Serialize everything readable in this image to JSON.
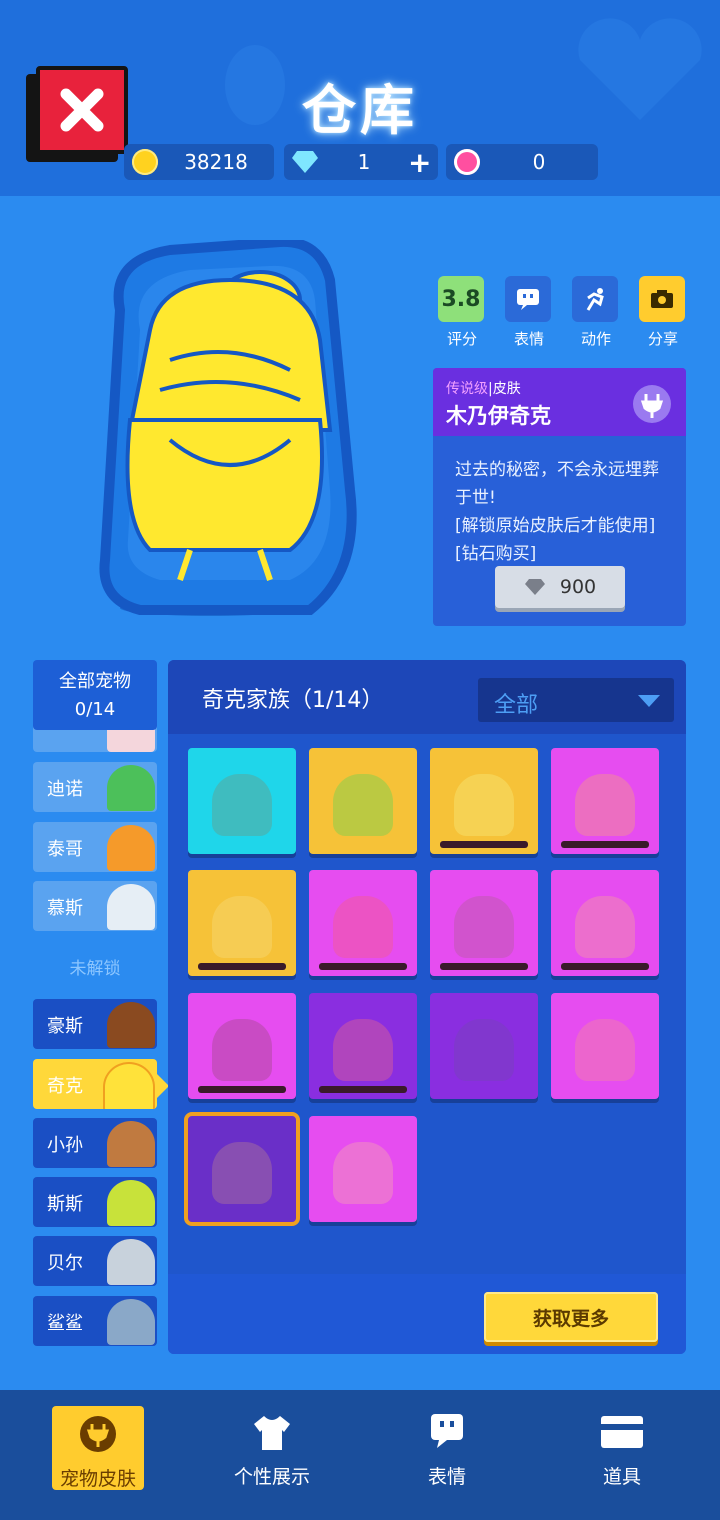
{
  "header": {
    "title": "仓库",
    "currencies": [
      {
        "icon": "gold-coin-icon",
        "value": "38218",
        "color": "#ffd21f"
      },
      {
        "icon": "diamond-icon",
        "value": "1",
        "color": "#7fe6ff"
      },
      {
        "icon": "lotus-icon",
        "value": "0",
        "color": "#ff4fa0"
      }
    ],
    "add_symbol": "+"
  },
  "actions": [
    {
      "name": "rating",
      "value": "3.8",
      "label": "评分",
      "color": "#8ee07a"
    },
    {
      "name": "emote",
      "label": "表情",
      "color": "#2b6ad8"
    },
    {
      "name": "motion",
      "label": "动作",
      "color": "#2b6ad8"
    },
    {
      "name": "share",
      "label": "分享",
      "color": "#ffcc2e"
    }
  ],
  "skin_info": {
    "rarity": "传说级",
    "separator": "|",
    "type": "皮肤",
    "name": "木乃伊奇克",
    "description": "过去的秘密，不会永远埋葬于世!\n[解锁原始皮肤后才能使用][钻石购买]",
    "price": "900"
  },
  "pet_list": {
    "all_label": "全部宠物",
    "all_count": "0/14",
    "unlocked_items": [
      "迪诺",
      "泰哥",
      "慕斯"
    ],
    "locked_label": "未解锁",
    "locked_items": [
      "豪斯",
      "奇克",
      "小孙",
      "斯斯",
      "贝尔",
      "鲨鲨"
    ],
    "selected": "奇克"
  },
  "family": {
    "title": "奇克家族（1/14）",
    "filter": "全部",
    "tiles": [
      {
        "bg": "#1fd6ea",
        "blob": "#5aa89a",
        "bar": false
      },
      {
        "bg": "#f6c238",
        "blob": "#8ad04a",
        "bar": false
      },
      {
        "bg": "#f6c238",
        "blob": "#f6e06a",
        "bar": true
      },
      {
        "bg": "#e64df0",
        "blob": "#f08a9a",
        "bar": true
      },
      {
        "bg": "#f6c238",
        "blob": "#f6d56a",
        "bar": true
      },
      {
        "bg": "#e64df0",
        "blob": "#f05aa0",
        "bar": true
      },
      {
        "bg": "#e64df0",
        "blob": "#c05ab0",
        "bar": true
      },
      {
        "bg": "#e64df0",
        "blob": "#f08ab0",
        "bar": true
      },
      {
        "bg": "#e64df0",
        "blob": "#b04aa0",
        "bar": true
      },
      {
        "bg": "#8a2ee0",
        "blob": "#d05aa0",
        "bar": true
      },
      {
        "bg": "#8a2ee0",
        "blob": "#7a40c0",
        "bar": false
      },
      {
        "bg": "#e64df0",
        "blob": "#f07ab0",
        "bar": false
      },
      {
        "bg": "#6a2fc8",
        "blob": "#a06aa0",
        "bar": false,
        "selected": true
      },
      {
        "bg": "#e64df0",
        "blob": "#f090c0",
        "bar": false
      }
    ],
    "get_more_label": "获取更多"
  },
  "bottom_nav": [
    {
      "label": "宠物皮肤",
      "active": true
    },
    {
      "label": "个性展示",
      "active": false
    },
    {
      "label": "表情",
      "active": false
    },
    {
      "label": "道具",
      "active": false
    }
  ]
}
